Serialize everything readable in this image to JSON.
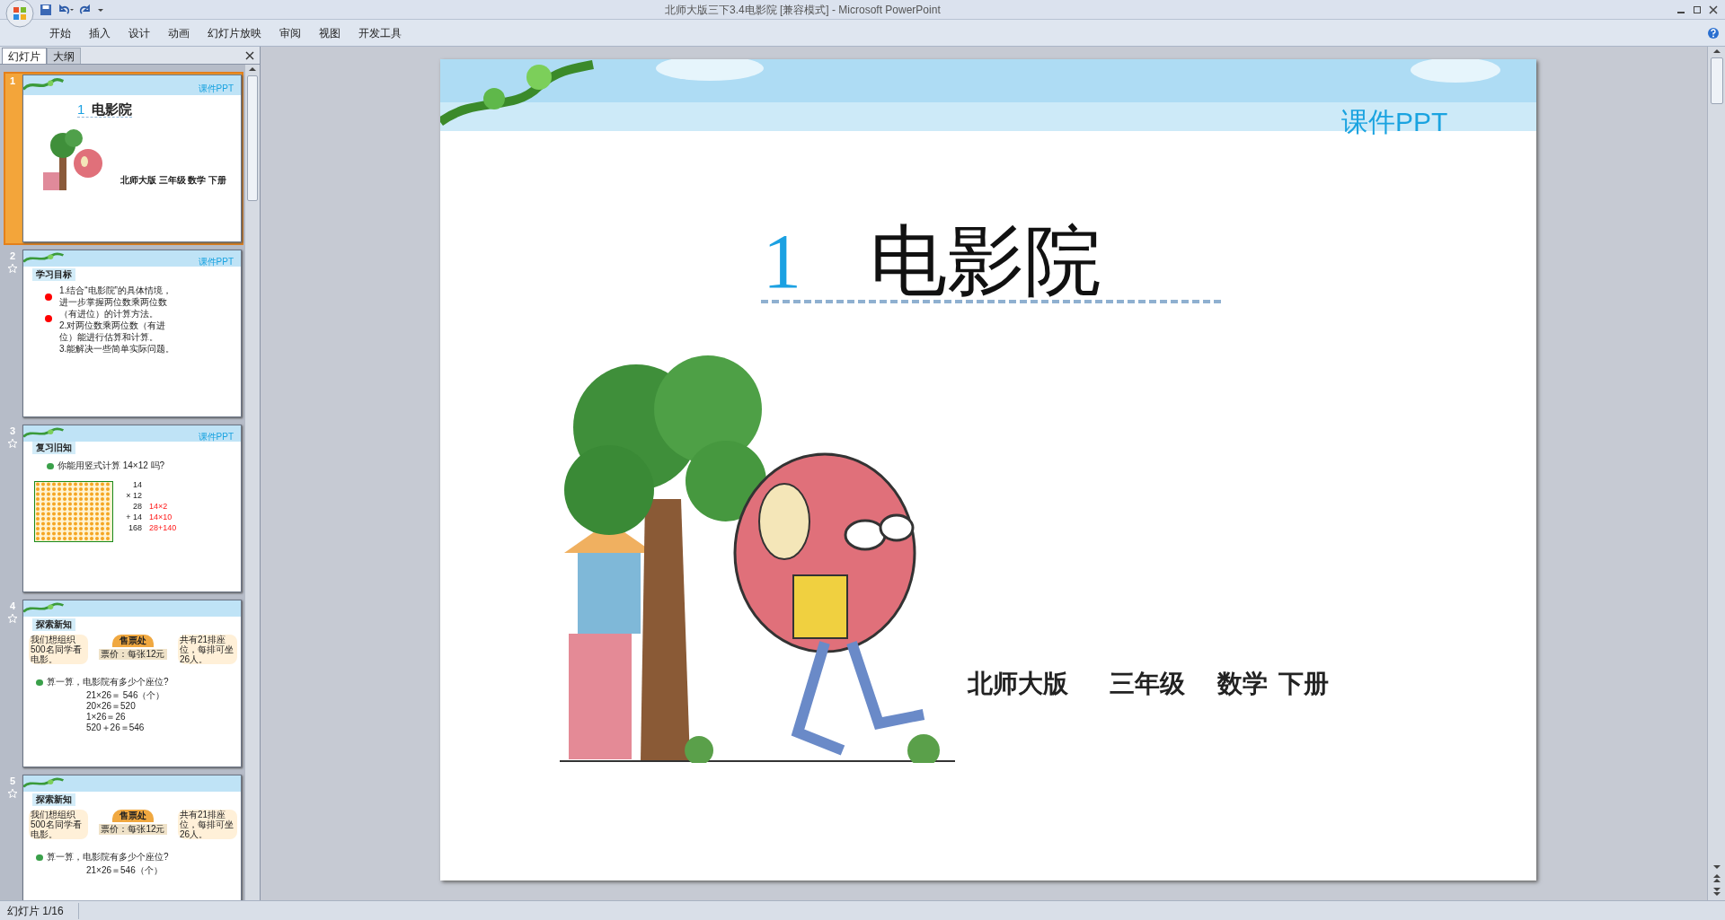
{
  "window": {
    "title": "北师大版三下3.4电影院 [兼容模式] - Microsoft PowerPoint"
  },
  "ribbon_tabs": [
    "开始",
    "插入",
    "设计",
    "动画",
    "幻灯片放映",
    "审阅",
    "视图",
    "开发工具"
  ],
  "panel_tabs": [
    {
      "label": "幻灯片",
      "selected": true
    },
    {
      "label": "大纲",
      "selected": false
    }
  ],
  "thumbnails": [
    {
      "number": "1",
      "selected": true,
      "starred": false,
      "kind": "title",
      "brand": "课件PPT",
      "title_number": "1",
      "title": "电影院",
      "subtitle": "北师大版 三年级 数学 下册"
    },
    {
      "number": "2",
      "selected": false,
      "starred": true,
      "kind": "bullets",
      "brand": "课件PPT",
      "heading": "学习目标",
      "lines": [
        "1.结合“电影院”的具体情境，",
        "进一步掌握两位数乘两位数",
        "（有进位）的计算方法。",
        "2.对两位数乘两位数（有进",
        "位）能进行估算和计算。",
        "3.能解决一些简单实际问题。"
      ]
    },
    {
      "number": "3",
      "selected": false,
      "starred": true,
      "kind": "review",
      "brand": "课件PPT",
      "heading": "复习旧知",
      "question": "你能用竖式计算 14×12 吗?",
      "rows": [
        {
          "value": "14"
        },
        {
          "value": "× 12"
        },
        {
          "value": "28",
          "note": "14×2"
        },
        {
          "value": "+ 14",
          "note": "14×10"
        },
        {
          "value": "168",
          "note": "28+140"
        }
      ]
    },
    {
      "number": "4",
      "selected": false,
      "starred": true,
      "kind": "explore",
      "heading": "探索新知",
      "sign": "售票处",
      "price": "票价：每张12元",
      "bubbles": [
        "我们想组织500名同学看电影。",
        "共有21排座位，每排可坐26人。"
      ],
      "question": "算一算，电影院有多少个座位?",
      "lines": [
        "21×26＝ 546（个）",
        "20×26＝520",
        "1×26＝26",
        "520＋26＝546"
      ]
    },
    {
      "number": "5",
      "selected": false,
      "starred": true,
      "kind": "explore",
      "heading": "探索新知",
      "sign": "售票处",
      "price": "票价：每张12元",
      "bubbles": [
        "我们想组织500名同学看电影。",
        "共有21排座位，每排可坐26人。"
      ],
      "question": "算一算，电影院有多少个座位?",
      "lines": [
        "21×26＝546（个）"
      ]
    }
  ],
  "slide": {
    "brand": "课件PPT",
    "number": "1",
    "title": "电影院",
    "subtitle": [
      "北师大版",
      "三年级",
      "数学",
      "下册"
    ]
  },
  "status_bar": {
    "text": "幻灯片 1/16"
  }
}
